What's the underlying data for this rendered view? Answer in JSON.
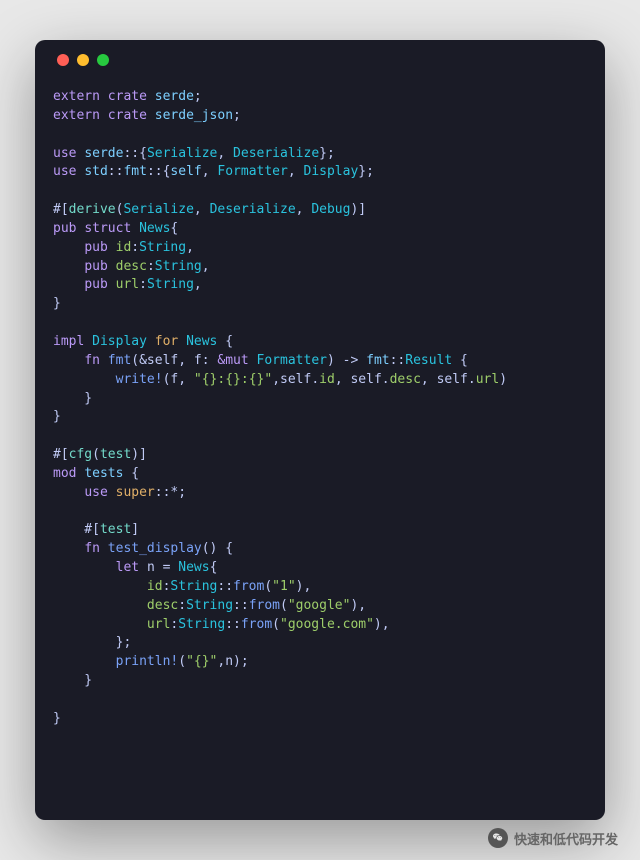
{
  "code": {
    "l01_extern": "extern",
    "l01_crate": "crate",
    "l01_serde": "serde",
    "l02_serde_json": "serde_json",
    "use": "use",
    "serde_path": "serde",
    "Serialize": "Serialize",
    "Deserialize": "Deserialize",
    "std": "std",
    "fmt": "fmt",
    "self": "self",
    "Formatter": "Formatter",
    "Display": "Display",
    "derive": "derive",
    "Debug": "Debug",
    "pub": "pub",
    "struct": "struct",
    "News": "News",
    "id": "id",
    "desc": "desc",
    "url": "url",
    "String": "String",
    "impl": "impl",
    "for": "for",
    "fn": "fn",
    "fmt_method": "fmt",
    "and_self": "&self",
    "f_arg": "f",
    "and_mut": "&mut",
    "arrow": "->",
    "Result": "Result",
    "write_macro": "write!",
    "fmt_str": "\"{}:{}:{}\"",
    "selfdot": "self",
    "cfg_test": "cfg",
    "test_lit": "test",
    "mod": "mod",
    "tests": "tests",
    "super_star": "super",
    "star": "*",
    "test_attr": "test",
    "test_display": "test_display",
    "let": "let",
    "n_var": "n",
    "from": "from",
    "str1": "\"1\"",
    "str_google": "\"google\"",
    "str_google_com": "\"google.com\"",
    "println": "println!",
    "fmt_brace": "\"{}\""
  },
  "footer": {
    "label": "快速和低代码开发"
  }
}
